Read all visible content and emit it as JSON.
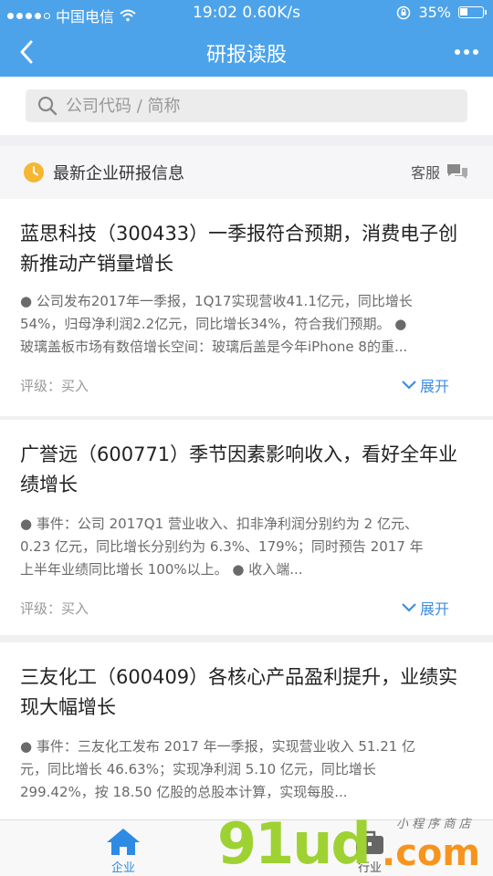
{
  "status_bar": {
    "carrier": "中国电信",
    "time_speed": "19:02 0.60K/s",
    "battery": "35%"
  },
  "nav": {
    "title": "研报读股"
  },
  "search": {
    "placeholder": "公司代码 / 简称"
  },
  "section": {
    "label": "最新企业研报信息",
    "service": "客服"
  },
  "reports": [
    {
      "title": "蓝思科技（300433）一季报符合预期，消费电子创新推动产销量增长",
      "summary_lines": [
        "● 公司发布2017年一季报，1Q17实现营收41.1亿元，同比增长",
        "54%，归母净利润2.2亿元，同比增长34%，符合我们预期。 ●",
        "玻璃盖板市场有数倍增长空间：玻璃后盖是今年iPhone 8的重..."
      ],
      "rating": "评级：买入",
      "expand": "展开"
    },
    {
      "title": "广誉远（600771）季节因素影响收入，看好全年业绩增长",
      "summary_lines": [
        "● 事件：公司 2017Q1 营业收入、扣非净利润分别约为 2 亿元、",
        "0.23 亿元，同比增长分别约为 6.3%、179%；同时预告 2017 年",
        "上半年业绩同比增长 100%以上。 ● 收入端..."
      ],
      "rating": "评级：买入",
      "expand": "展开"
    },
    {
      "title": "三友化工（600409）各核心产品盈利提升，业绩实现大幅增长",
      "summary_lines": [
        "● 事件：三友化工发布 2017 年一季报，实现营业收入 51.21 亿",
        "元，同比增长 46.63%；实现净利润 5.10 亿元，同比增长",
        "299.42%，按 18.50 亿股的总股本计算，实现每股..."
      ]
    }
  ],
  "tabs": {
    "company": "企业",
    "industry": "行业"
  },
  "watermark": {
    "brand": "91ud",
    "com": ".com",
    "sub": "小 程 序 商 店"
  },
  "colors": {
    "primary": "#4da3ea",
    "link": "#3d8de0",
    "clock": "#f5b731"
  }
}
